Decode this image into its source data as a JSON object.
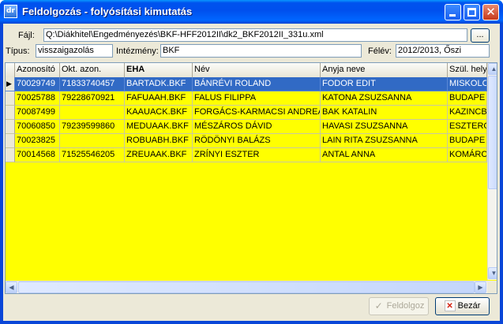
{
  "window": {
    "title": "Feldolgozás - folyósítási kimutatás",
    "app_icon_text": "dr"
  },
  "form": {
    "file_label": "Fájl:",
    "file_value": "Q:\\Diákhitel\\Engedményezés\\BKF-HFF2012II\\dk2_BKF2012II_331u.xml",
    "browse_label": "...",
    "type_label": "Típus:",
    "type_value": "visszaigazolás",
    "institution_label": "Intézmény:",
    "institution_value": "BKF",
    "semester_label": "Félév:",
    "semester_value": "2012/2013, Őszi"
  },
  "grid": {
    "columns": [
      "Azonosító",
      "Okt. azon.",
      "EHA",
      "Név",
      "Anyja neve",
      "Szül. hely"
    ],
    "rows": [
      [
        "70029749",
        "71833740457",
        "BARTADK.BKF",
        "BÁNRÉVI ROLAND",
        "FODOR EDIT",
        "MISKOLC"
      ],
      [
        "70025788",
        "79228670921",
        "FAFUAAH.BKF",
        "FALUS FILIPPA",
        "KATONA ZSUZSANNA",
        "BUDAPE"
      ],
      [
        "70087499",
        "",
        "KAAUACK.BKF",
        "FORGÁCS-KARMACSI ANDREA",
        "BAK KATALIN",
        "KAZINCB"
      ],
      [
        "70060850",
        "79239599860",
        "MEDUAAK.BKF",
        "MÉSZÁROS DÁVID",
        "HAVASI ZSUZSANNA",
        "ESZTERG"
      ],
      [
        "70023825",
        "",
        "ROBUABH.BKF",
        "RÖDÖNYI BALÁZS",
        "LAIN RITA ZSUZSANNA",
        "BUDAPE"
      ],
      [
        "70014568",
        "71525546205",
        "ZREUAAK.BKF",
        "ZRÍNYI ESZTER",
        "ANTAL ANNA",
        "KOMÁRC"
      ]
    ],
    "selected_row": 0,
    "row_indicator": "▶"
  },
  "buttons": {
    "process_label": "Feldolgoz",
    "close_label": "Bezár"
  },
  "colors": {
    "grid_background": "#ffff00",
    "selection": "#316ac5",
    "titlebar": "#0053ee"
  }
}
